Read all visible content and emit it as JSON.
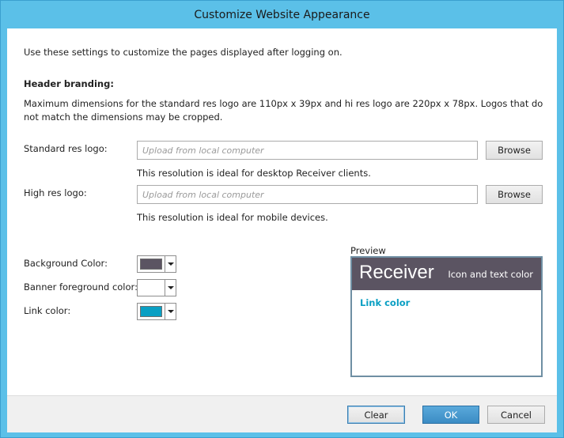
{
  "window": {
    "title": "Customize Website Appearance"
  },
  "intro": "Use these settings to customize the pages displayed after logging on.",
  "header_branding": {
    "heading": "Header branding:",
    "description": "Maximum dimensions for the standard res logo are 110px x 39px and hi res logo are 220px x 78px. Logos that do not match the dimensions may be cropped."
  },
  "standard_logo": {
    "label": "Standard res logo:",
    "placeholder": "Upload from local computer",
    "browse_label": "Browse",
    "hint": "This resolution is ideal for desktop Receiver clients."
  },
  "high_logo": {
    "label": "High res logo:",
    "placeholder": "Upload from local computer",
    "browse_label": "Browse",
    "hint": "This resolution is ideal for mobile devices."
  },
  "colors": {
    "background": {
      "label": "Background Color:",
      "value": "#5b5462"
    },
    "banner_foreground": {
      "label": "Banner foreground color:",
      "value": "#ffffff"
    },
    "link": {
      "label": "Link color:",
      "value": "#0a9fc3"
    }
  },
  "preview": {
    "label": "Preview",
    "logo_text": "Receiver",
    "icon_text": "Icon and text color",
    "link_text": "Link color"
  },
  "buttons": {
    "clear": "Clear",
    "ok": "OK",
    "cancel": "Cancel"
  }
}
